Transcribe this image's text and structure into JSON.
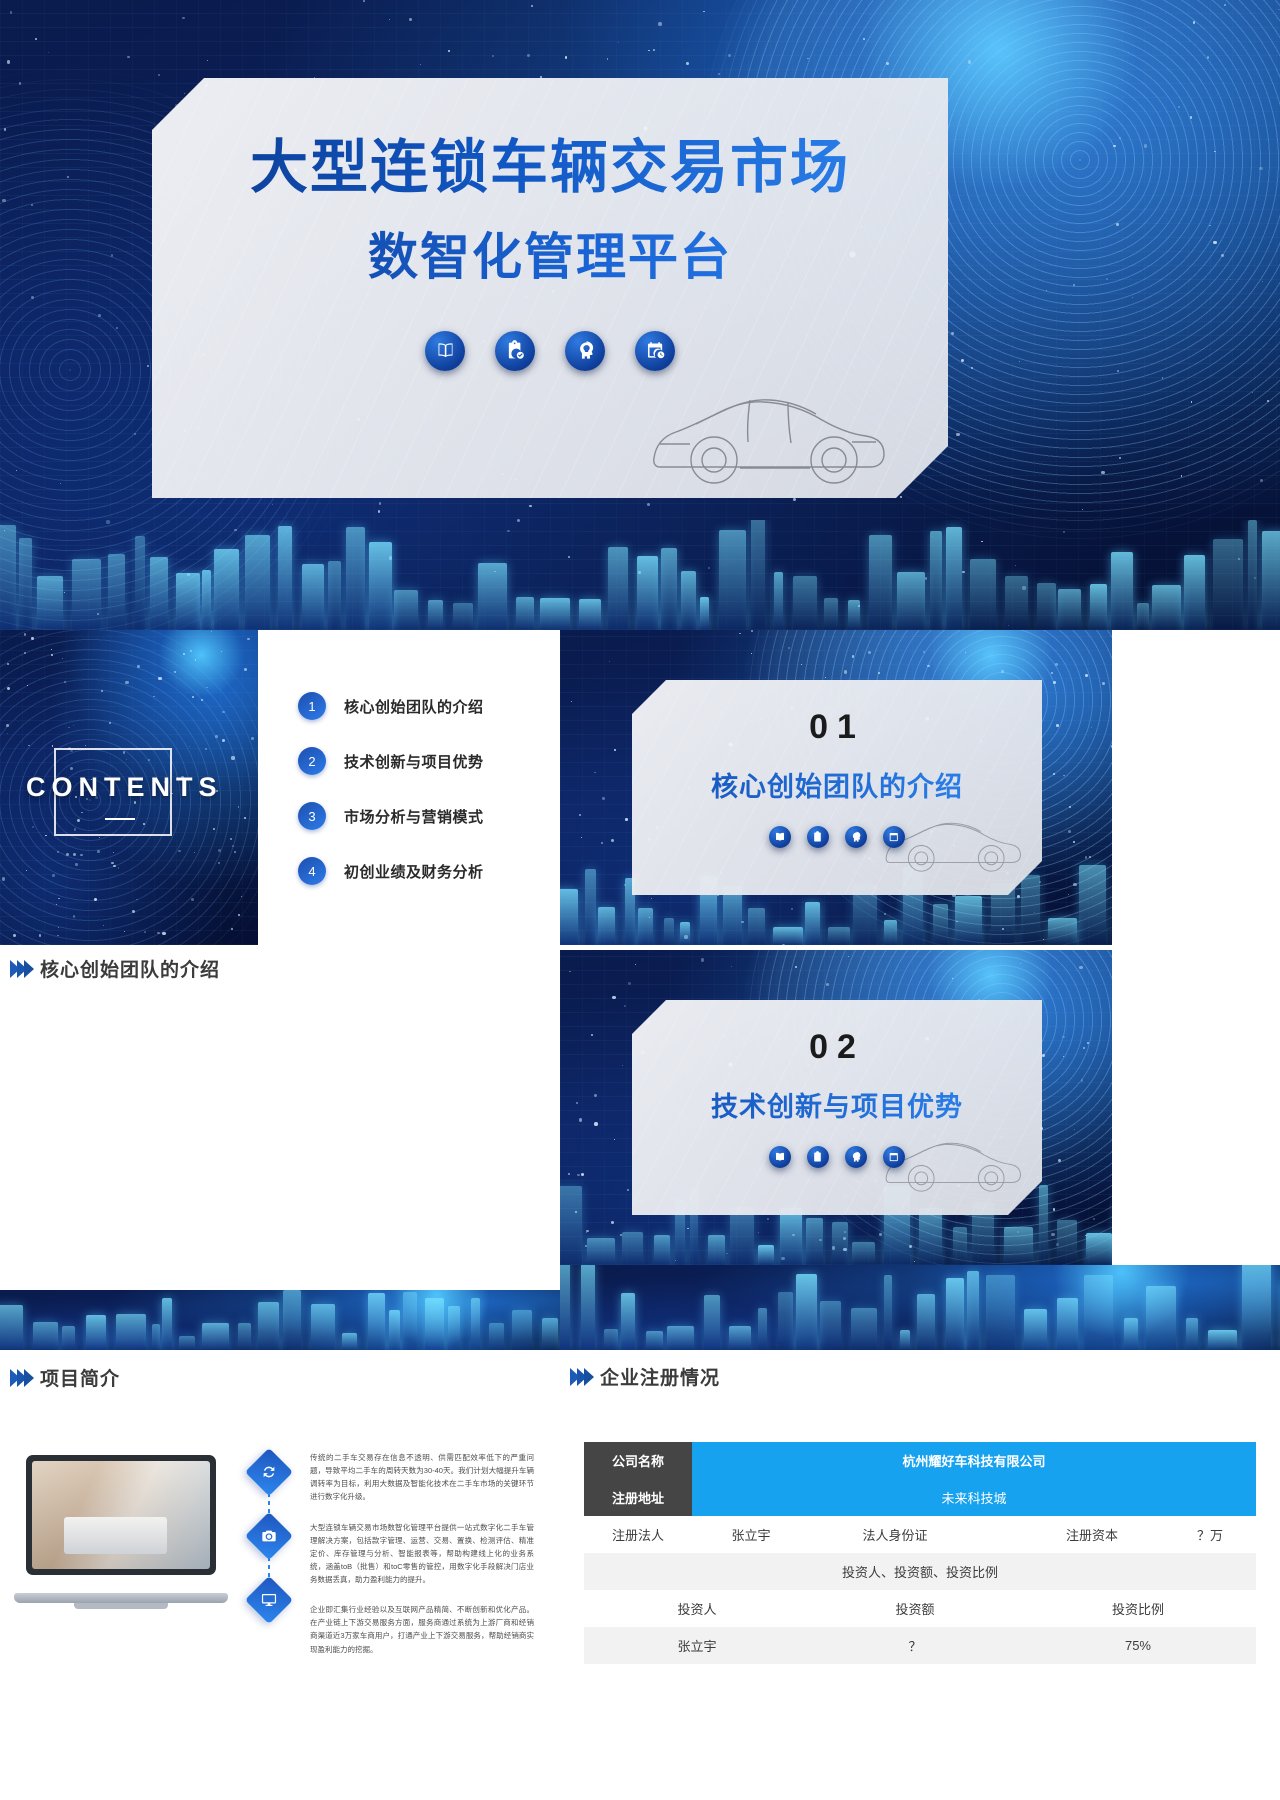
{
  "cover": {
    "title": "大型连锁车辆交易市场",
    "subtitle": "数智化管理平台",
    "icons": [
      "book-icon",
      "clipboard-check-icon",
      "head-bulb-icon",
      "calendar-clock-icon"
    ]
  },
  "contents": {
    "label": "CONTENTS",
    "items": [
      {
        "num": "1",
        "label": "核心创始团队的介绍"
      },
      {
        "num": "2",
        "label": "技术创新与项目优势"
      },
      {
        "num": "3",
        "label": "市场分析与营销模式"
      },
      {
        "num": "4",
        "label": "初创业绩及财务分析"
      }
    ]
  },
  "sections": [
    {
      "num": "01",
      "title": "核心创始团队的介绍"
    },
    {
      "num": "02",
      "title": "技术创新与项目优势"
    }
  ],
  "headers": {
    "team": "核心创始团队的介绍",
    "project": "项目简介",
    "registration": "企业注册情况"
  },
  "project_intro": {
    "paragraphs": [
      "传统的二手车交易存在信息不透明、供需匹配效率低下的严重问题，导致平均二手车的周转天数为30-40天。我们计划大幅提升车辆调转率为目标，利用大数据及智能化技术在二手车市场的关键环节进行数字化升级。",
      "大型连锁车辆交易市场数智化管理平台提供一站式数字化二手车管理解决方案，包括款字管理、运营、交易、置换、检测评估、精准定价、库存管理与分析、智能报表等，帮助构建线上化的业务系统，涵盖toB（批售）和toC零售的管控，用数字化手段解决门店业务数据丢真，助力盈利能力的提升。",
      "企业即汇集行业经验以及互联网产品精简、不断创新和优化产品。在产业链上下游交易服务方面，服务商通过系统为上游厂商和经销商渠道近3万家车商用户，打通产业上下游交易服务，帮助经销商实现盈利能力的挖掘。"
    ],
    "icons": [
      "refresh-icon",
      "camera-icon",
      "monitor-icon"
    ]
  },
  "registration_table": {
    "rows": [
      {
        "type": "kv",
        "key": "公司名称",
        "value": "杭州耀好车科技有限公司"
      },
      {
        "type": "kv",
        "key": "注册地址",
        "value": "未来科技城"
      },
      {
        "type": "quad",
        "cells": [
          "注册法人",
          "张立宇",
          "法人身份证",
          "",
          "注册资本",
          "？万"
        ]
      },
      {
        "type": "span",
        "value": "投资人、投资额、投资比例"
      },
      {
        "type": "head",
        "cells": [
          "投资人",
          "投资额",
          "投资比例"
        ]
      },
      {
        "type": "data",
        "cells": [
          "张立宇",
          "？",
          "75%"
        ]
      }
    ]
  },
  "colors": {
    "accent_blue": "#16a2ef",
    "dark_key": "#454545",
    "title_blue": "#1157c4",
    "deep_navy": "#0a1b4d"
  }
}
